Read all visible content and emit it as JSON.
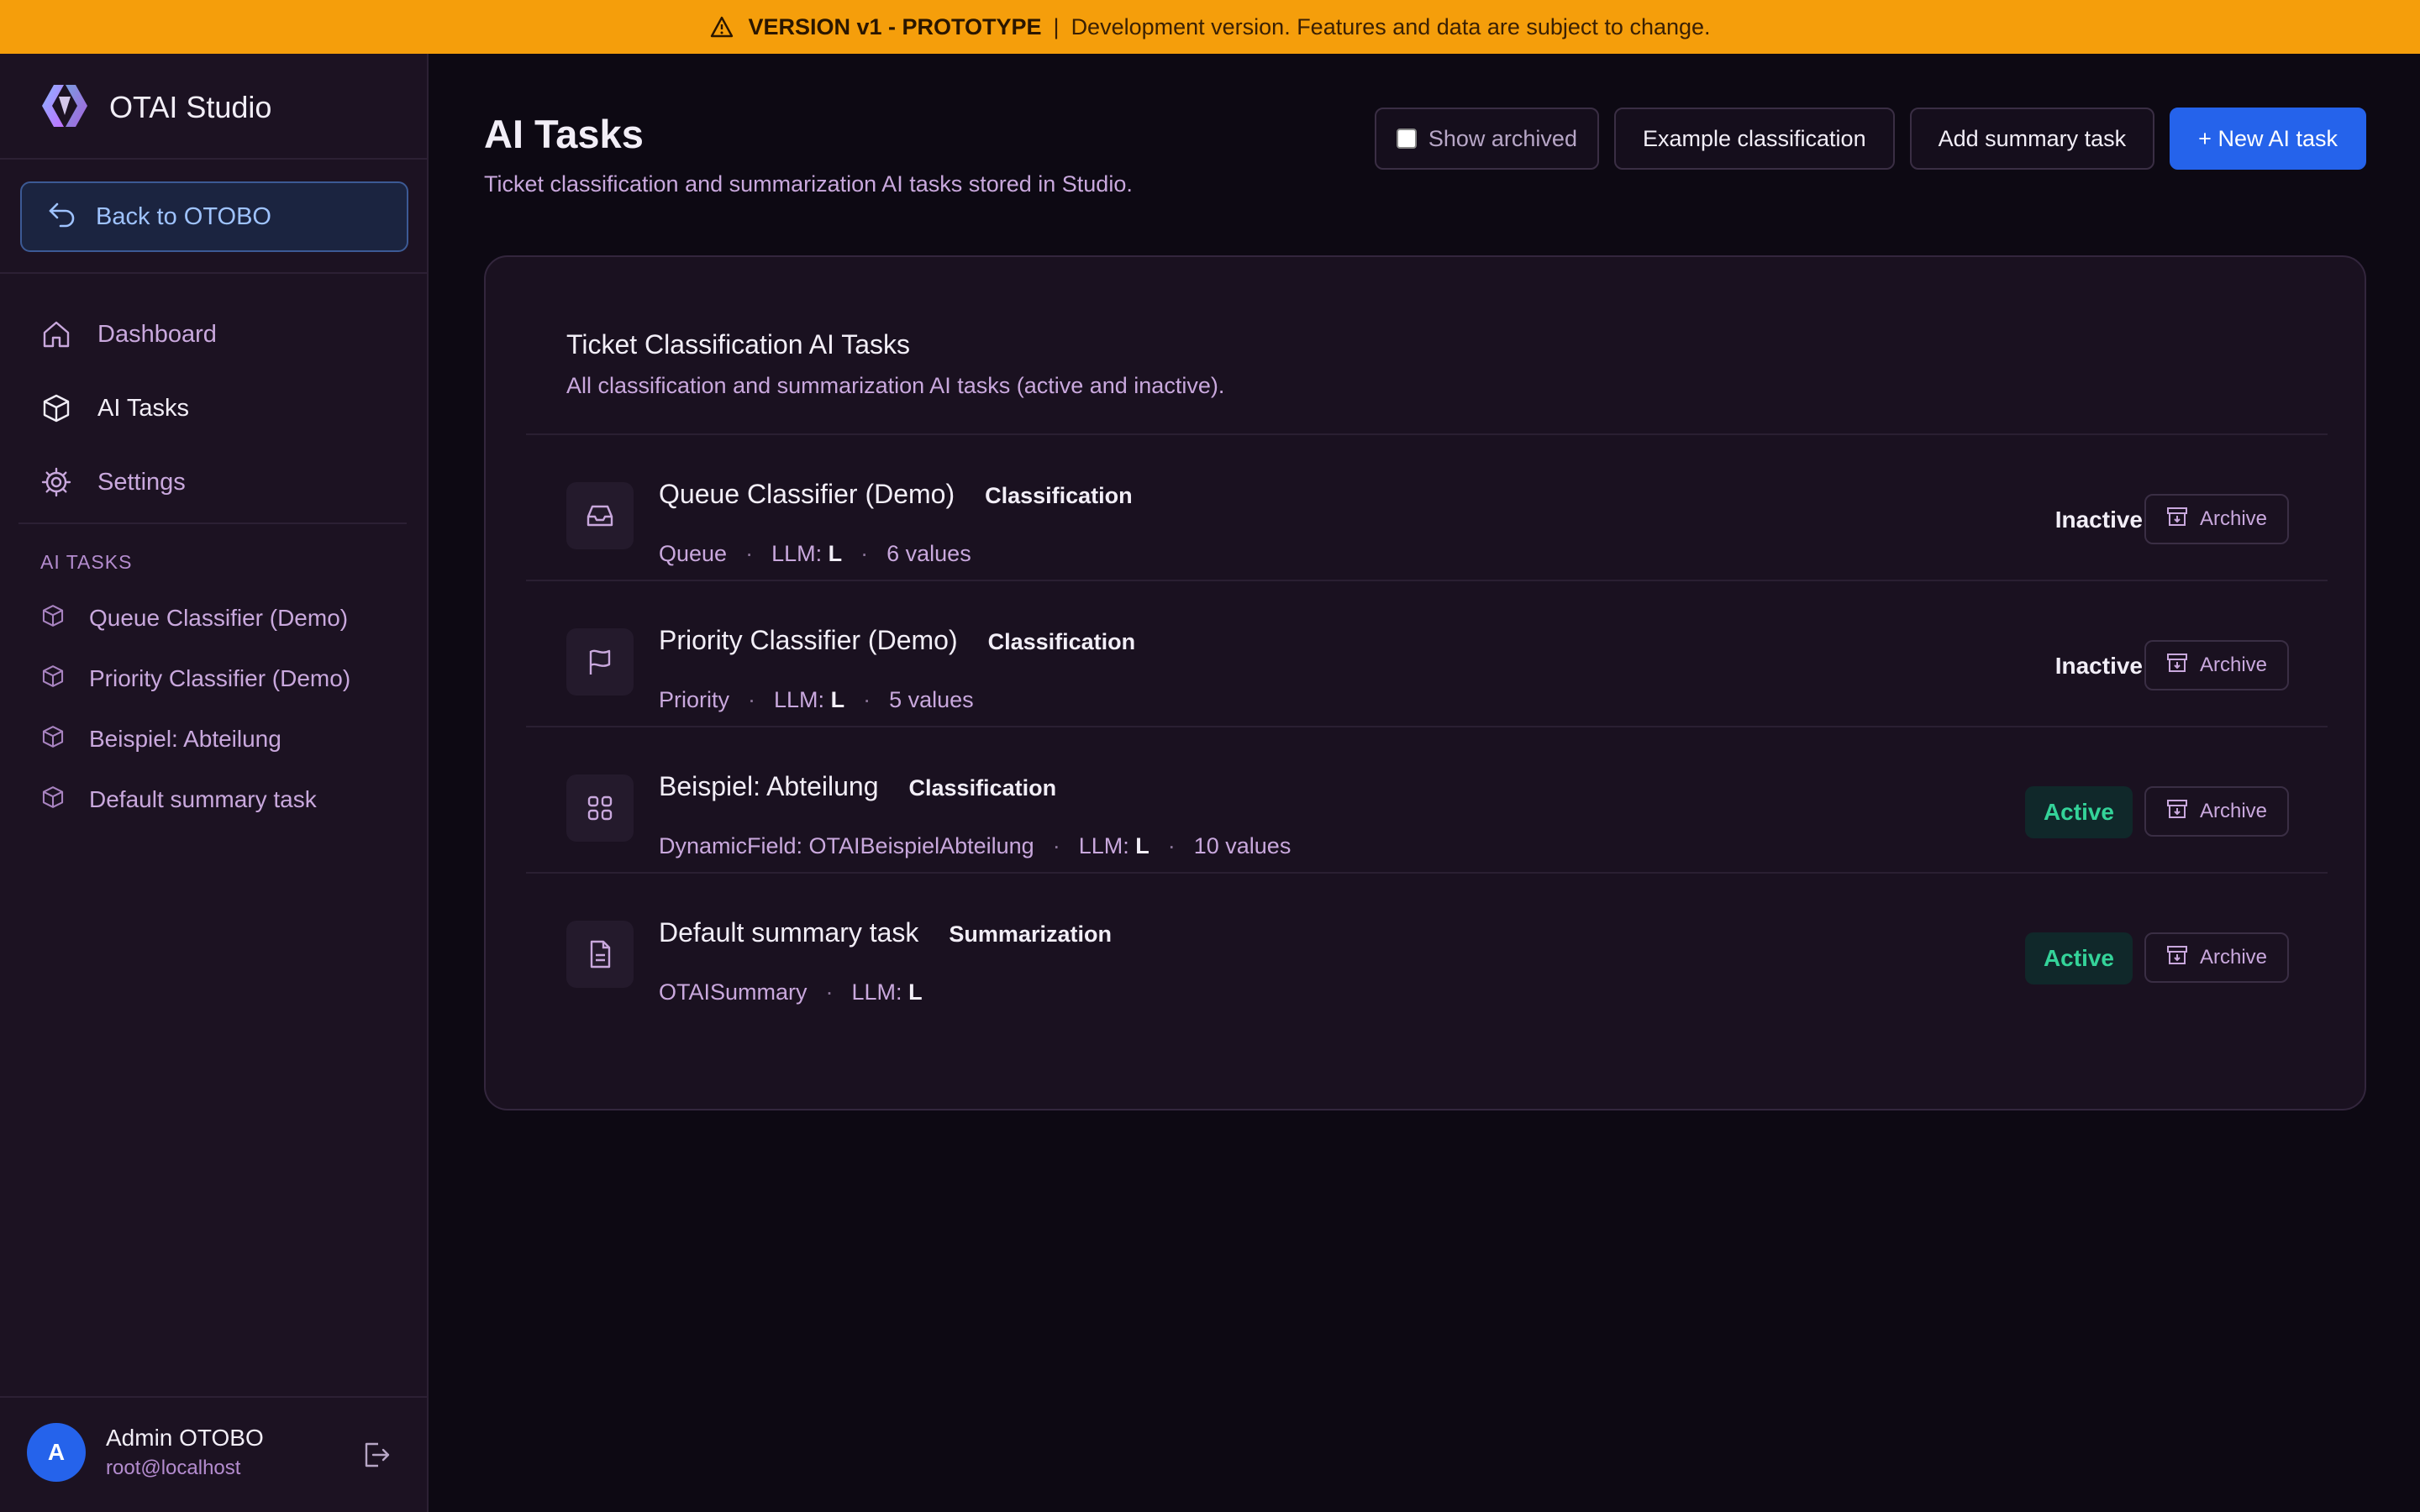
{
  "banner": {
    "version": "VERSION v1 - PROTOTYPE",
    "message": "Development version. Features and data are subject to change."
  },
  "sidebar": {
    "brand": "OTAI Studio",
    "back_label": "Back to OTOBO",
    "nav": [
      {
        "label": "Dashboard",
        "icon": "home-icon"
      },
      {
        "label": "AI Tasks",
        "icon": "cube-icon"
      },
      {
        "label": "Settings",
        "icon": "gear-icon"
      }
    ],
    "section_label": "AI TASKS",
    "tasks": [
      "Queue Classifier (Demo)",
      "Priority Classifier (Demo)",
      "Beispiel: Abteilung",
      "Default summary task"
    ],
    "user": {
      "initial": "A",
      "name": "Admin OTOBO",
      "email": "root@localhost"
    }
  },
  "header": {
    "title": "AI Tasks",
    "subtitle": "Ticket classification and summarization AI tasks stored in Studio.",
    "show_archived": "Show archived",
    "example_btn": "Example classification",
    "summary_btn": "Add summary task",
    "new_btn": "+ New AI task"
  },
  "card": {
    "title": "Ticket Classification AI Tasks",
    "subtitle": "All classification and summarization AI tasks (active and inactive).",
    "rows": [
      {
        "name": "Queue Classifier (Demo)",
        "type": "Classification",
        "field": "Queue",
        "llm_label": "LLM:",
        "llm": "L",
        "values": "6 values",
        "status": "Inactive",
        "archive": "Archive",
        "icon": "inbox-icon"
      },
      {
        "name": "Priority Classifier (Demo)",
        "type": "Classification",
        "field": "Priority",
        "llm_label": "LLM:",
        "llm": "L",
        "values": "5 values",
        "status": "Inactive",
        "archive": "Archive",
        "icon": "flag-icon"
      },
      {
        "name": "Beispiel: Abteilung",
        "type": "Classification",
        "field": "DynamicField: OTAIBeispielAbteilung",
        "llm_label": "LLM:",
        "llm": "L",
        "values": "10 values",
        "status": "Active",
        "archive": "Archive",
        "icon": "grid-icon"
      },
      {
        "name": "Default summary task",
        "type": "Summarization",
        "field": "OTAISummary",
        "llm_label": "LLM:",
        "llm": "L",
        "values": "",
        "status": "Active",
        "archive": "Archive",
        "icon": "document-icon"
      }
    ]
  },
  "colors": {
    "banner": "#f59e0b",
    "primary": "#2563eb",
    "active": "#34d399"
  }
}
